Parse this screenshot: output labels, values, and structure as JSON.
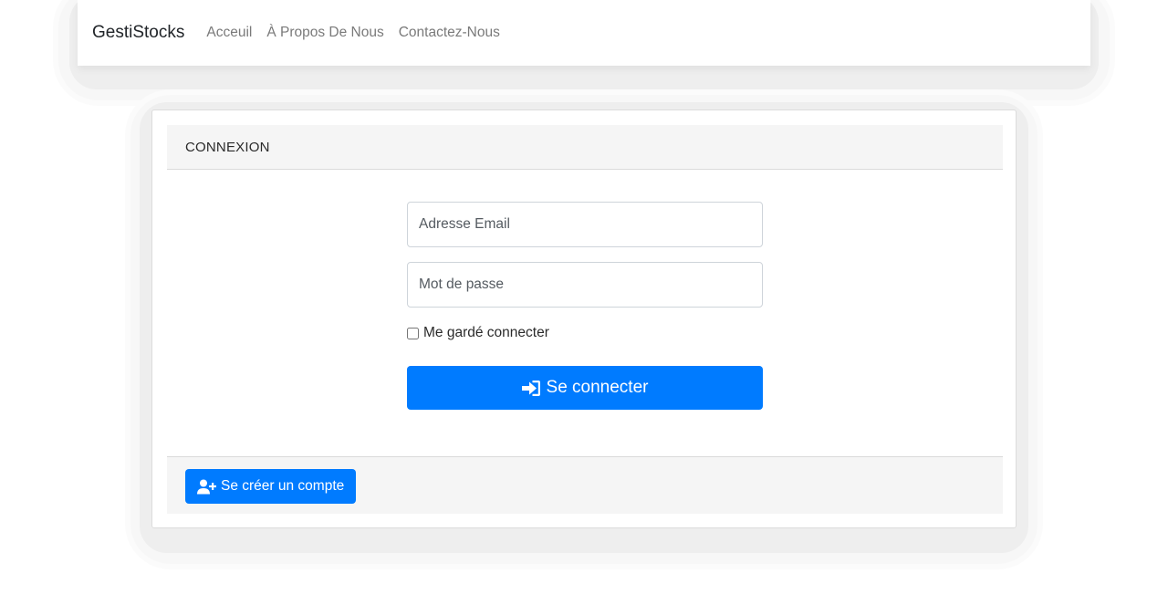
{
  "navbar": {
    "brand": "GestiStocks",
    "links": [
      "Acceuil",
      "À Propos De Nous",
      "Contactez-Nous"
    ]
  },
  "login_card": {
    "header": "CONNEXION",
    "email_placeholder": "Adresse Email",
    "password_placeholder": "Mot de passe",
    "remember_label": "Me gardé connecter",
    "remember_checked": false,
    "submit_label": "Se connecter",
    "submit_icon": "sign-in-icon"
  },
  "footer": {
    "register_label": "Se créer un compte",
    "register_icon": "user-plus-icon"
  },
  "colors": {
    "primary": "#007bff",
    "header_bg": "#f5f5f5",
    "nav_link": "#7a7a7a"
  }
}
